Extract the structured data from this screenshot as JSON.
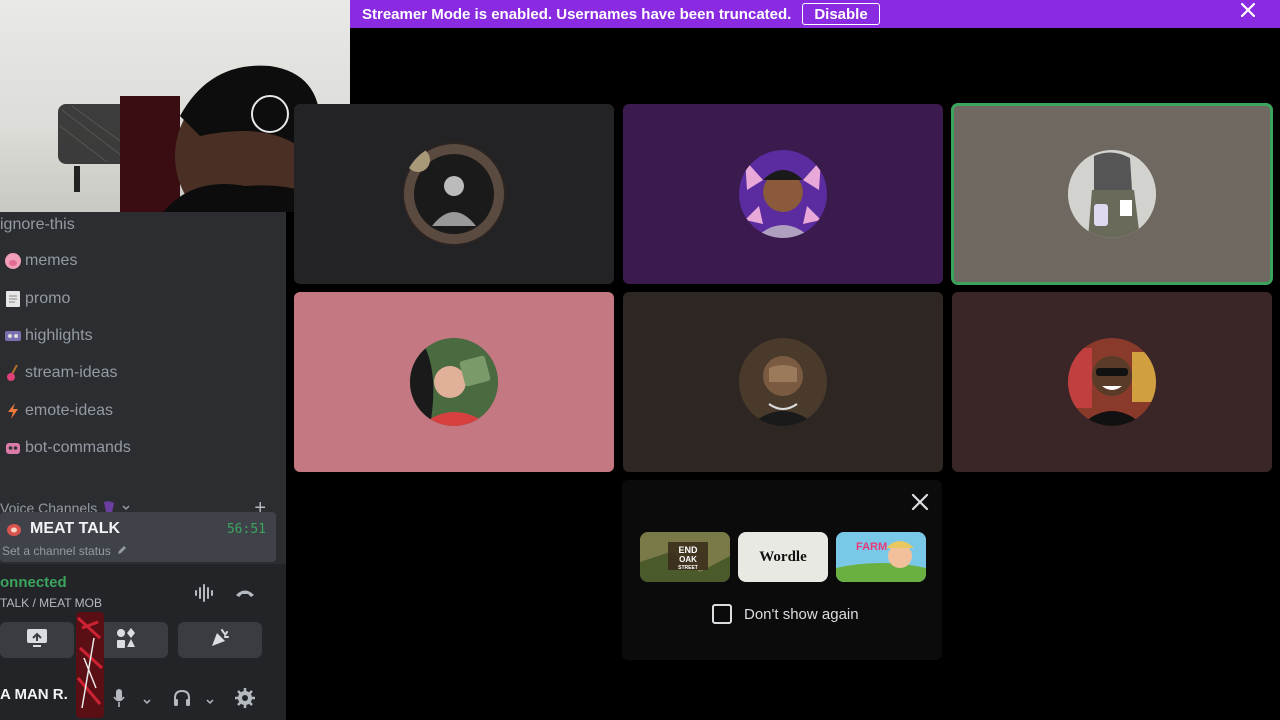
{
  "banner": {
    "message": "Streamer Mode is enabled. Usernames have been truncated.",
    "disable_label": "Disable"
  },
  "channels": [
    {
      "label": "ignore-this",
      "icon": ""
    },
    {
      "label": "memes",
      "icon": "pig-emoji"
    },
    {
      "label": "promo",
      "icon": "page-emoji"
    },
    {
      "label": "highlights",
      "icon": "tape-emoji"
    },
    {
      "label": "stream-ideas",
      "icon": "guitar-emoji"
    },
    {
      "label": "emote-ideas",
      "icon": "bolt-emoji"
    },
    {
      "label": "bot-commands",
      "icon": "robot-emoji"
    }
  ],
  "voice_section": {
    "header": "Voice Channels",
    "channel_name": "MEAT TALK",
    "elapsed": "56:51",
    "status_placeholder": "Set a channel status"
  },
  "voice_panel": {
    "connected_label": "onnected",
    "location": "TALK / MEAT MOB",
    "username": "A MAN R."
  },
  "popup": {
    "activities": [
      "The End of Oak Street",
      "Wordle",
      "Farm Merge Valley"
    ],
    "wordle_label": "Wordle",
    "dont_show_label": "Don't show again"
  },
  "colors": {
    "banner": "#8a2be2",
    "connected": "#3ba55d",
    "speaking_border": "#3ba55d"
  }
}
